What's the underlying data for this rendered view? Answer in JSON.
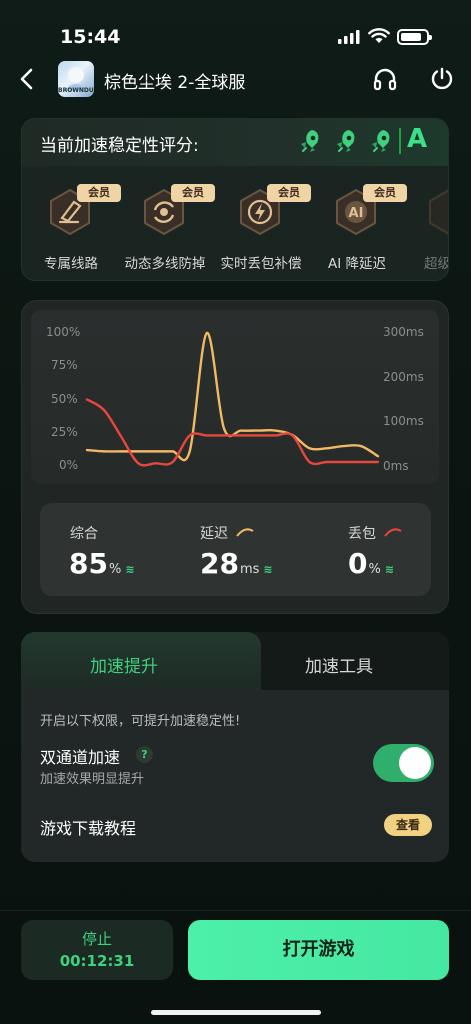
{
  "status_bar": {
    "time": "15:44"
  },
  "header": {
    "title": "棕色尘埃 2-全球服",
    "thumb_text": "BROWNDUST"
  },
  "stability": {
    "title": "当前加速稳定性评分:",
    "grade": "A",
    "rockets": 3,
    "features": [
      {
        "label": "专属线路",
        "badge": "会员",
        "icon": "shield-line-icon"
      },
      {
        "label": "动态多线防掉",
        "badge": "会员",
        "icon": "multi-line-icon"
      },
      {
        "label": "实时丢包补偿",
        "badge": "会员",
        "icon": "lightning-icon"
      },
      {
        "label": "AI 降延迟",
        "badge": "会员",
        "icon": "ai-icon"
      },
      {
        "label": "超级",
        "badge": "",
        "icon": "more-icon"
      }
    ]
  },
  "chart_data": {
    "type": "line",
    "left_axis_ticks": [
      "100%",
      "75%",
      "50%",
      "25%",
      "0%"
    ],
    "right_axis_ticks": [
      "300ms",
      "200ms",
      "100ms",
      "0ms"
    ],
    "series": [
      {
        "name": "延迟",
        "color": "#f2b865",
        "axis": "right-ms",
        "values": [
          36,
          33,
          33,
          33,
          33,
          33,
          33,
          300,
          85,
          80,
          80,
          80,
          70,
          40,
          40,
          45,
          45,
          22
        ]
      },
      {
        "name": "丢包",
        "color": "#e8473d",
        "axis": "left-pct",
        "values": [
          50,
          42,
          22,
          2,
          2,
          3,
          23,
          23,
          23,
          23,
          23,
          23,
          23,
          3,
          3,
          3,
          3,
          3
        ]
      }
    ]
  },
  "stats": {
    "overall": {
      "label": "综合",
      "value": "85",
      "unit": "%"
    },
    "latency": {
      "label": "延迟",
      "value": "28",
      "unit": "ms"
    },
    "loss": {
      "label": "丢包",
      "value": "0",
      "unit": "%"
    }
  },
  "tabs": {
    "boost": "加速提升",
    "tools": "加速工具"
  },
  "settings": {
    "hint": "开启以下权限，可提升加速稳定性!",
    "dual_channel": {
      "title": "双通道加速",
      "help": "?",
      "sub": "加速效果明显提升",
      "enabled": true
    },
    "download": {
      "title": "游戏下载教程",
      "button": "查看"
    }
  },
  "bottom": {
    "stop_label": "停止",
    "elapsed": "00:12:31",
    "play_label": "打开游戏"
  },
  "colors": {
    "accent": "#3fd17d",
    "vip": "#f1d4a6",
    "play": "#4df0a8"
  }
}
